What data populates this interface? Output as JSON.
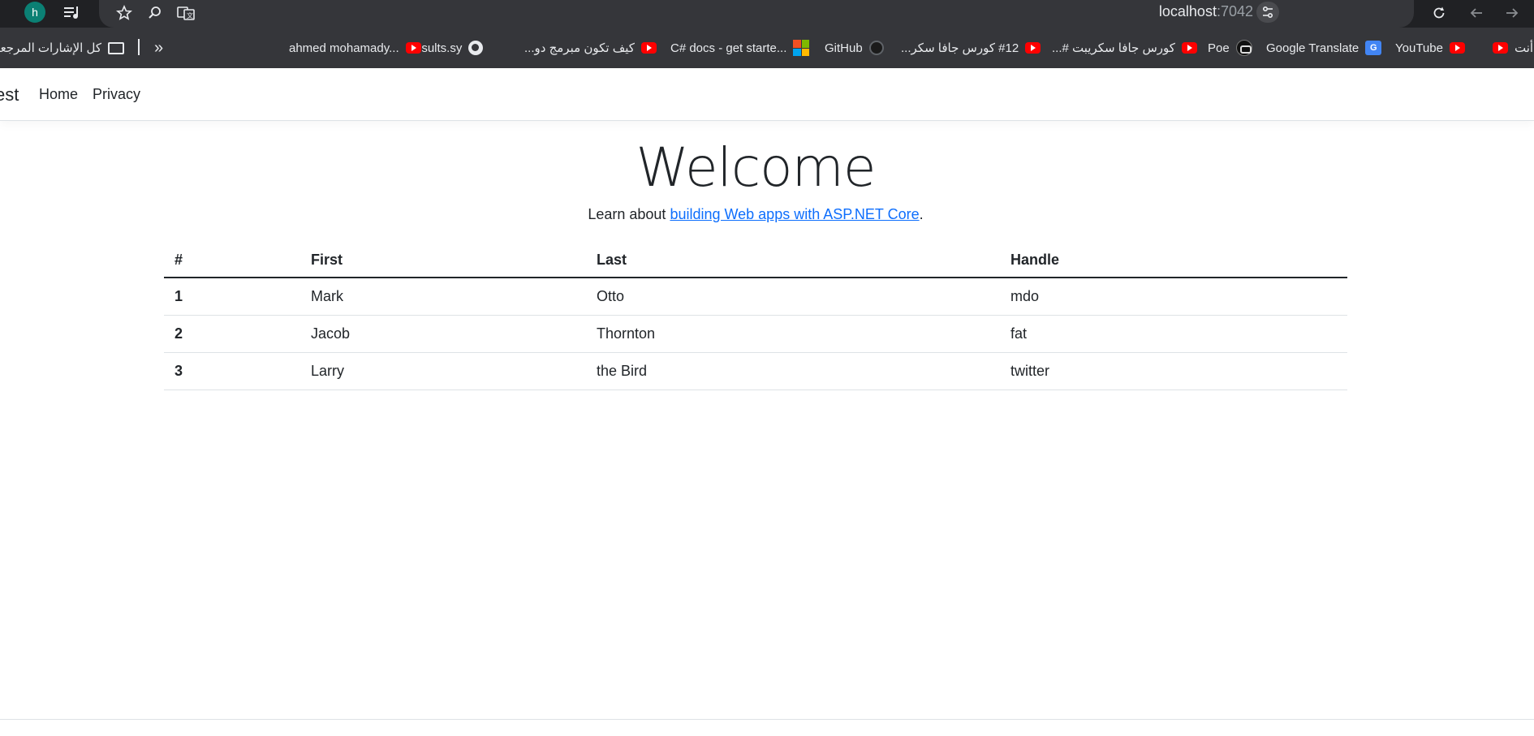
{
  "browser": {
    "profile_initial": "h",
    "url_host": "localhost",
    "url_port": ":7042",
    "bookmarks": [
      {
        "label": "أنت",
        "icon": "youtube-icon"
      },
      {
        "label": "YouTube",
        "icon": "youtube-icon"
      },
      {
        "label": "Google Translate",
        "icon": "google-translate-icon"
      },
      {
        "label": "Poe",
        "icon": "poe-icon"
      },
      {
        "label": "كورس جافا سكريبت #...",
        "icon": "youtube-icon"
      },
      {
        "label": "#12 كورس جافا سكر...",
        "icon": "youtube-icon"
      },
      {
        "label": "GitHub",
        "icon": "github-icon"
      },
      {
        "label": "C# docs - get starte...",
        "icon": "microsoft-icon"
      },
      {
        "label": "كيف تكون مبرمج دو...",
        "icon": "youtube-icon"
      },
      {
        "label": "results.sy",
        "icon": "globe-icon"
      },
      {
        "label": "ahmed mohamady...",
        "icon": "youtube-icon"
      }
    ],
    "all_bookmarks_label": "كل الإشارات المرجعية"
  },
  "site": {
    "brand": "est",
    "nav": [
      "Home",
      "Privacy"
    ]
  },
  "main": {
    "title": "Welcome",
    "lead_prefix": "Learn about ",
    "lead_link": "building Web apps with ASP.NET Core",
    "lead_suffix": "."
  },
  "table": {
    "headers": [
      "#",
      "First",
      "Last",
      "Handle"
    ],
    "rows": [
      [
        "1",
        "Mark",
        "Otto",
        "mdo"
      ],
      [
        "2",
        "Jacob",
        "Thornton",
        "fat"
      ],
      [
        "3",
        "Larry",
        "the Bird",
        "twitter"
      ]
    ]
  }
}
